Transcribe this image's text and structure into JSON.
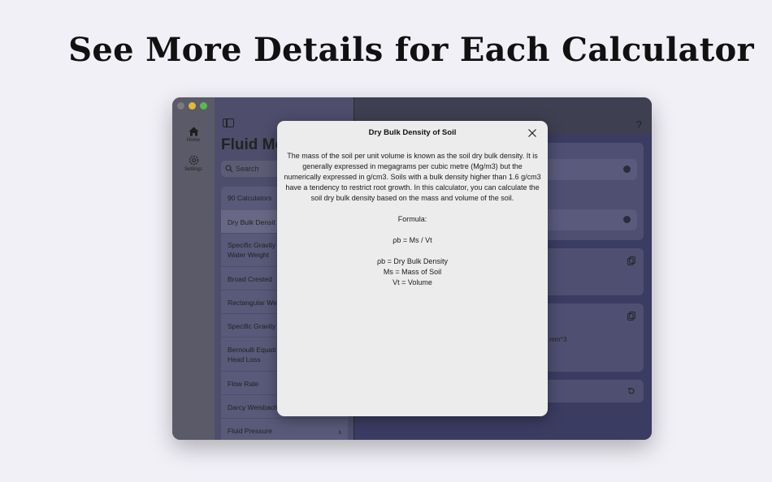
{
  "headline": "See More Details for Each Calculator",
  "rail": {
    "items": [
      {
        "label": "Home",
        "icon": "house-icon"
      },
      {
        "label": "Settings",
        "icon": "gear-icon"
      }
    ]
  },
  "sidebar": {
    "title": "Fluid Me",
    "search_placeholder": "Search",
    "items": [
      {
        "label": "90 Calculators"
      },
      {
        "label": "Dry Bulk Densit"
      },
      {
        "label": "Specific Gravity",
        "label2": "Water Weight"
      },
      {
        "label": "Broad Crested "
      },
      {
        "label": "Rectangular We"
      },
      {
        "label": "Specific Gravity"
      },
      {
        "label": "Bernoulli Equati",
        "label2": "Head Loss"
      },
      {
        "label": "Flow Rate"
      },
      {
        "label": "Darcy Weisbach"
      },
      {
        "label": "Fluid Pressure"
      }
    ]
  },
  "main": {
    "help_label": "?",
    "result_unit": "mm^3"
  },
  "modal": {
    "title": "Dry Bulk Density of Soil",
    "description": "The mass of the soil per unit volume is known as the soil dry bulk density. It is generally expressed in megagrams per cubic metre (Mg/m3) but the numerically expressed in g/cm3. Soils with a bulk density higher than 1.6 g/cm3 have a tendency to restrict root growth. In this calculator, you can calculate the soil dry bulk density based on the mass and volume of the soil.",
    "formula_label": "Formula:",
    "formula": "ρb = Ms / Vt",
    "legend": [
      "ρb = Dry Bulk Density",
      "Ms = Mass of Soil",
      "Vt = Volume"
    ]
  }
}
